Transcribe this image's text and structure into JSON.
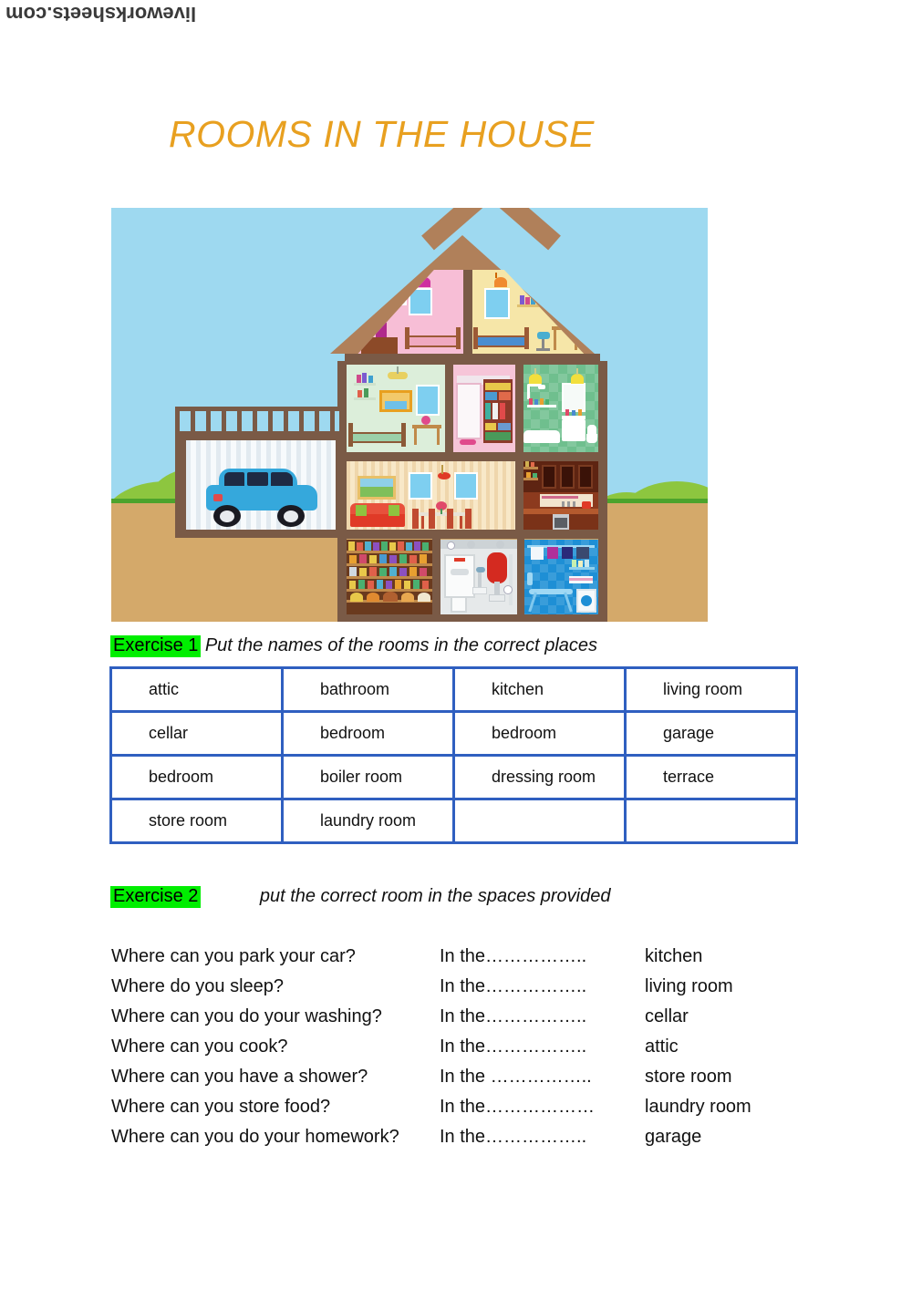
{
  "watermark": {
    "text": "liveworksheets.com"
  },
  "title": "ROOMS IN THE HOUSE",
  "colors": {
    "title": "#E8A020",
    "highlight": "#00EE00",
    "table_border": "#2F5FC0",
    "sky": "#9ED9F0",
    "soil": "#D4A96A",
    "grass": "#4CA32C",
    "roof": "#B0805A",
    "wall": "#7A5A46",
    "car": "#35A8DC",
    "sofa": "#E03A27"
  },
  "illustration": {
    "alt": "cross-section of a house showing all rooms",
    "rooms": [
      {
        "name": "bedroom-attic-pink",
        "floor": "attic",
        "wall_color": "#F7BED6"
      },
      {
        "name": "bedroom-attic-yellow",
        "floor": "attic",
        "wall_color": "#F6E6A8"
      },
      {
        "name": "bedroom-green",
        "floor": "first",
        "wall_color": "#D9EBD2"
      },
      {
        "name": "dressing-room",
        "floor": "first",
        "wall_color": "#F6C5D8"
      },
      {
        "name": "bathroom",
        "floor": "first",
        "wall_color": "#6FBF8E"
      },
      {
        "name": "terrace",
        "floor": "first",
        "wall_color": "#9ED9F0"
      },
      {
        "name": "living-room",
        "floor": "ground",
        "wall_color": "#F6E2BE"
      },
      {
        "name": "dining-area",
        "floor": "ground",
        "wall_color": "#F6E2BE"
      },
      {
        "name": "kitchen",
        "floor": "ground",
        "wall_color": "#8C3A1E"
      },
      {
        "name": "garage",
        "floor": "ground",
        "wall_color": "#EFF4F7"
      },
      {
        "name": "store-room",
        "floor": "cellar",
        "wall_color": "#8B5A2B"
      },
      {
        "name": "boiler-room",
        "floor": "cellar",
        "wall_color": "#E6E9EA"
      },
      {
        "name": "laundry-room",
        "floor": "cellar",
        "wall_color": "#1E8FD5"
      }
    ]
  },
  "exercise1": {
    "label": "Exercise 1",
    "instruction": "Put the names of the rooms in the correct places",
    "table": {
      "rows": [
        [
          "attic",
          "bathroom",
          "kitchen",
          "living room"
        ],
        [
          "cellar",
          "bedroom",
          "bedroom",
          "garage"
        ],
        [
          "bedroom",
          "boiler room",
          "dressing room",
          "terrace"
        ],
        [
          "store room",
          "laundry room",
          "",
          ""
        ]
      ]
    }
  },
  "exercise2": {
    "label": "Exercise 2",
    "instruction": "put the correct room in the spaces provided",
    "questions": [
      {
        "question": "Where can you park your car?",
        "blank": "In the……………..",
        "answer": "kitchen"
      },
      {
        "question": "Where do  you sleep?",
        "blank": "In the……………..",
        "answer": "living room"
      },
      {
        "question": "Where can you do your washing?",
        "blank": "In the……………..",
        "answer": "cellar"
      },
      {
        "question": "Where can you cook?",
        "blank": "In the……………..",
        "answer": "attic"
      },
      {
        "question": "Where can you have a shower?",
        "blank": "In the ……………..",
        "answer": "store room"
      },
      {
        "question": "Where can you store food?",
        "blank": "In the………………",
        "answer": " laundry room"
      },
      {
        "question": "Where can you do your homework?",
        "blank": "In the……………..",
        "answer": "garage"
      }
    ]
  }
}
